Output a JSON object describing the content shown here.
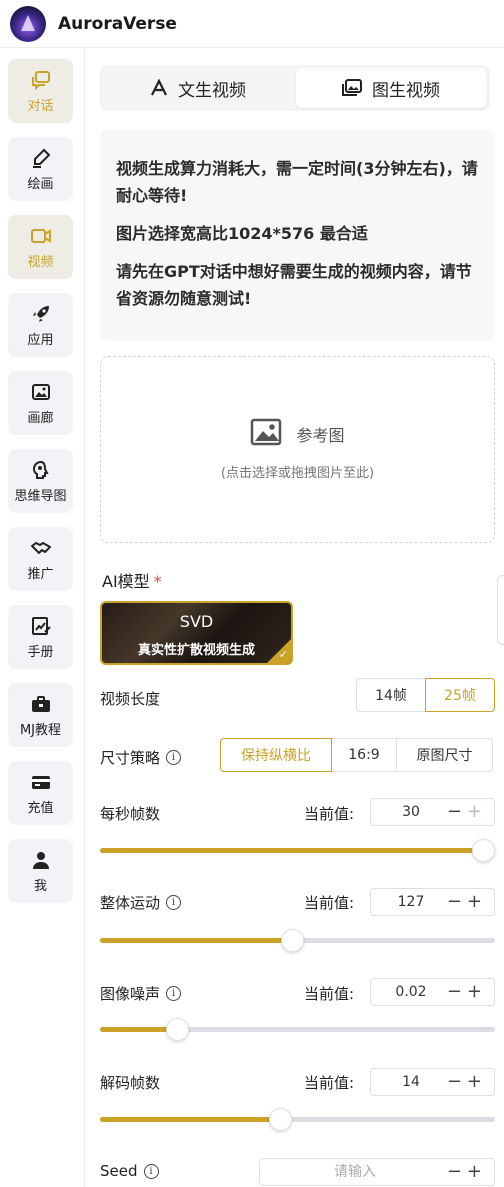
{
  "app": {
    "title": "AuroraVerse"
  },
  "colors": {
    "accent": "#c9a227",
    "sidebar_bg": "#f1f3f6",
    "active_bg": "#efece6",
    "required": "#e04848"
  },
  "sidebar": {
    "items": [
      {
        "label": "对话",
        "icon": "chat-icon",
        "active": true
      },
      {
        "label": "绘画",
        "icon": "brush-icon",
        "active": false
      },
      {
        "label": "视频",
        "icon": "video-icon",
        "active": true
      },
      {
        "label": "应用",
        "icon": "rocket-icon",
        "active": false
      },
      {
        "label": "画廊",
        "icon": "gallery-icon",
        "active": false
      },
      {
        "label": "思维导图",
        "icon": "mindmap-icon",
        "active": false
      },
      {
        "label": "推广",
        "icon": "handshake-icon",
        "active": false
      },
      {
        "label": "手册",
        "icon": "manual-icon",
        "active": false
      },
      {
        "label": "MJ教程",
        "icon": "toolbox-icon",
        "active": false
      },
      {
        "label": "充值",
        "icon": "card-icon",
        "active": false
      },
      {
        "label": "我",
        "icon": "user-icon",
        "active": false
      }
    ]
  },
  "tabs": [
    {
      "label": "文生视频",
      "icon": "text-icon",
      "selected": false
    },
    {
      "label": "图生视频",
      "icon": "image-icon",
      "selected": true
    }
  ],
  "notice": {
    "lines": [
      "视频生成算力消耗大，需一定时间(3分钟左右)，请耐心等待!",
      "图片选择宽高比1024*576 最合适",
      "请先在GPT对话中想好需要生成的视频内容，请节省资源勿随意测试!"
    ]
  },
  "upload": {
    "label": "参考图",
    "hint": "(点击选择或拖拽图片至此)"
  },
  "model": {
    "label": "AI模型",
    "required_mark": "*",
    "card": {
      "name": "SVD",
      "description": "真实性扩散视频生成",
      "selected": true
    }
  },
  "video_length": {
    "label": "视频长度",
    "options": [
      {
        "label": "14帧",
        "selected": false
      },
      {
        "label": "25帧",
        "selected": true
      }
    ]
  },
  "size_strategy": {
    "label": "尺寸策略",
    "options": [
      {
        "label": "保持纵横比",
        "selected": true
      },
      {
        "label": "16:9",
        "selected": false
      },
      {
        "label": "原图尺寸",
        "selected": false
      }
    ]
  },
  "params": {
    "current_label": "当前值:",
    "fps": {
      "label": "每秒帧数",
      "value": "30",
      "level": 1.0
    },
    "motion": {
      "label": "整体运动",
      "value": "127",
      "level": 0.5
    },
    "noise": {
      "label": "图像噪声",
      "value": "0.02",
      "level": 0.2
    },
    "decode": {
      "label": "解码帧数",
      "value": "14",
      "level": 0.47
    }
  },
  "seed": {
    "label": "Seed",
    "placeholder": "请输入"
  }
}
